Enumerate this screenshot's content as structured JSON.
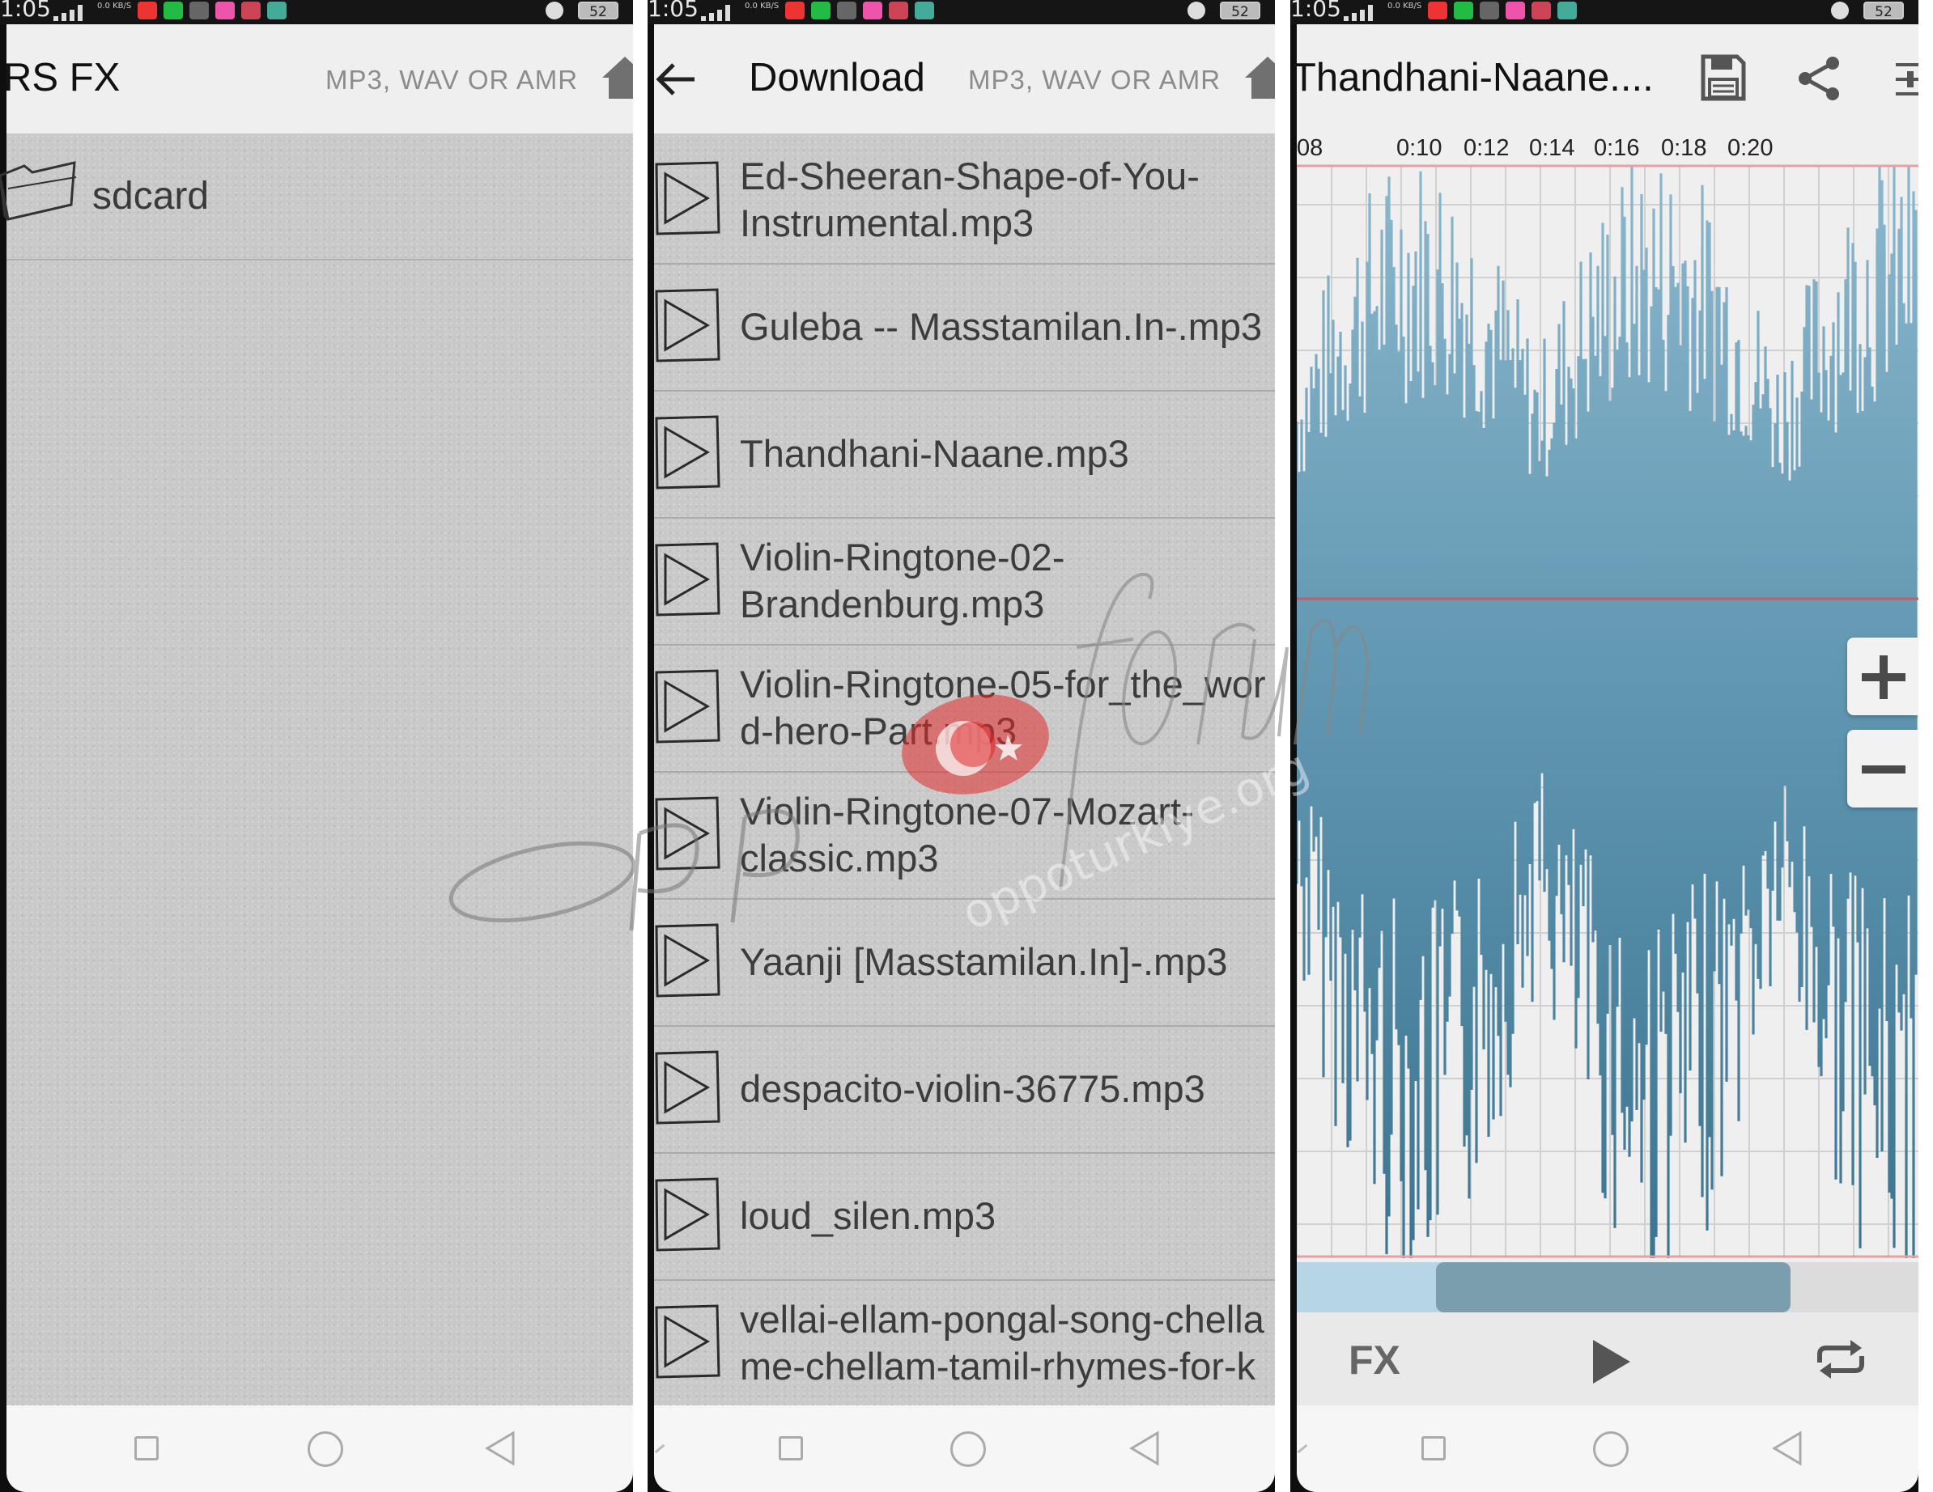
{
  "status_bar": {
    "time": "1:05",
    "net_speed": "0.0 KB/S",
    "battery": "52"
  },
  "panel_main": {
    "title": "RS FX",
    "subtitle": "MP3, WAV OR AMR",
    "items": [
      {
        "label": "sdcard",
        "icon": "folder-icon"
      }
    ]
  },
  "panel_download": {
    "title": "Download",
    "subtitle": "MP3, WAV OR AMR",
    "files": [
      {
        "name": "Ed-Sheeran-Shape-of-You-\nInstrumental.mp3"
      },
      {
        "name": "Guleba -- Masstamilan.In-.mp3"
      },
      {
        "name": "Thandhani-Naane.mp3"
      },
      {
        "name": "Violin-Ringtone-02-\nBrandenburg.mp3"
      },
      {
        "name": "Violin-Ringtone-05-for_the_wor\nd-hero-Part.mp3"
      },
      {
        "name": "Violin-Ringtone-07-Mozart-\nclassic.mp3"
      },
      {
        "name": "Yaanji [Masstamilan.In]-.mp3"
      },
      {
        "name": "despacito-violin-36775.mp3"
      },
      {
        "name": "loud_silen.mp3"
      },
      {
        "name": "vellai-ellam-pongal-song-chella\nme-chellam-tamil-rhymes-for-k"
      }
    ]
  },
  "panel_editor": {
    "title": "Thandhani-Naane....",
    "timeline": [
      ":08",
      "0:10",
      "0:12",
      "0:14",
      "0:16",
      "0:18",
      "0:20"
    ],
    "fx_label": "FX",
    "toolbar": [
      "save-icon",
      "share-icon",
      "settings-icon"
    ],
    "colors": {
      "wave_light": "#8ab7cd",
      "wave_dark": "#3c7590",
      "scrub": "#7b9eae"
    }
  },
  "watermark": {
    "text": "oppoforum",
    "url": "oppoturkiye.org"
  }
}
